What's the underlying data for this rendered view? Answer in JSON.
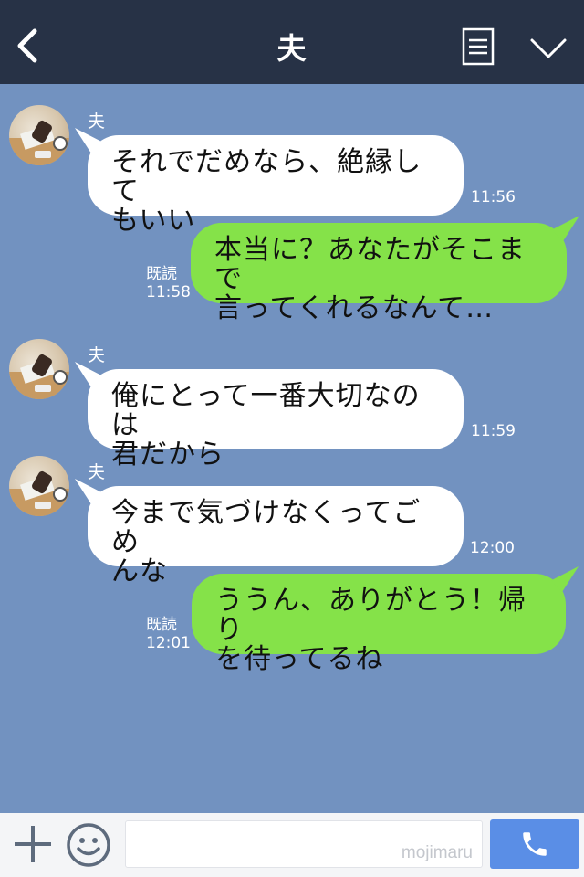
{
  "header": {
    "title": "夫",
    "back_icon": "chevron-left-icon",
    "menu_icon": "memo-icon",
    "dropdown_icon": "chevron-down-icon",
    "bg_color": "#273246"
  },
  "chat": {
    "bg_color": "#7292c0",
    "messages": [
      {
        "side": "in",
        "sender": "夫",
        "text": "それでだめなら、絶縁して\nもいい",
        "time": "11:56"
      },
      {
        "side": "out",
        "read": "既読",
        "text": "本当に？あなたがそこまで\n言ってくれるなんて…",
        "time": "11:58"
      },
      {
        "side": "in",
        "sender": "夫",
        "text": "俺にとって一番大切なのは\n君だから",
        "time": "11:59"
      },
      {
        "side": "in",
        "sender": "夫",
        "text": "今まで気づけなくってごめ\nんな",
        "time": "12:00"
      },
      {
        "side": "out",
        "read": "既読",
        "text": "ううん、ありがとう！帰り\nを待ってるね",
        "time": "12:01"
      }
    ],
    "incoming_bubble_color": "#ffffff",
    "outgoing_bubble_color": "#85e249"
  },
  "input_bar": {
    "plus_icon": "plus-icon",
    "sticker_icon": "smiley-icon",
    "watermark": "mojimaru",
    "call_icon": "phone-icon",
    "call_color": "#5a8ee6"
  }
}
